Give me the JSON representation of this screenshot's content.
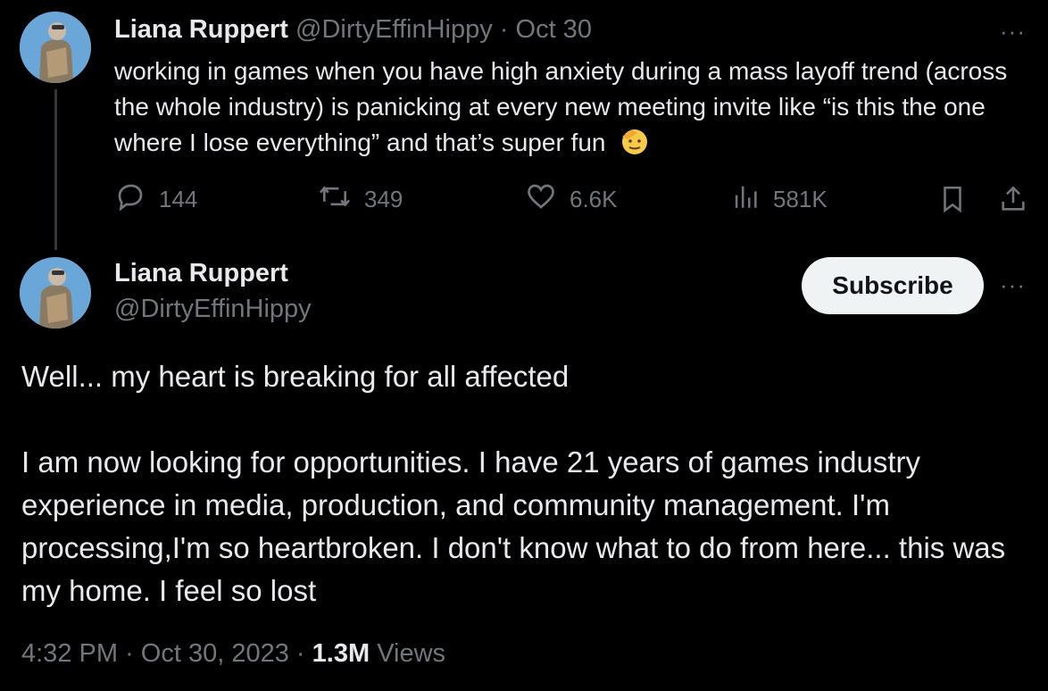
{
  "reply_tweet": {
    "author_name": "Liana Ruppert",
    "author_handle": "@DirtyEffinHippy",
    "date_separator": "·",
    "date": "Oct 30",
    "more": "···",
    "text": "working in games when you have high anxiety during a mass layoff trend (across the whole industry) is panicking at every new meeting invite like “is this the one where I lose everything” and that’s super fun",
    "emoji": "saluting-face",
    "stats": {
      "replies": "144",
      "reposts": "349",
      "likes": "6.6K",
      "views": "581K"
    }
  },
  "main_tweet": {
    "author_name": "Liana Ruppert",
    "author_handle": "@DirtyEffinHippy",
    "subscribe_label": "Subscribe",
    "more": "···",
    "paragraph_1": "Well... my heart is breaking for all affected",
    "paragraph_2": "I am now looking for opportunities. I have 21 years of games industry experience in media, production, and community management. I'm processing,I'm so heartbroken. I don't know what to do from here... this was my home. I feel so lost",
    "time": "4:32 PM",
    "sep1": "·",
    "date": "Oct 30, 2023",
    "sep2": "·",
    "views_count": "1.3M",
    "views_label": "Views"
  },
  "colors": {
    "background": "#000000",
    "text": "#e7e9ea",
    "muted": "#71767b",
    "avatar_bg": "#6aa6d8"
  }
}
